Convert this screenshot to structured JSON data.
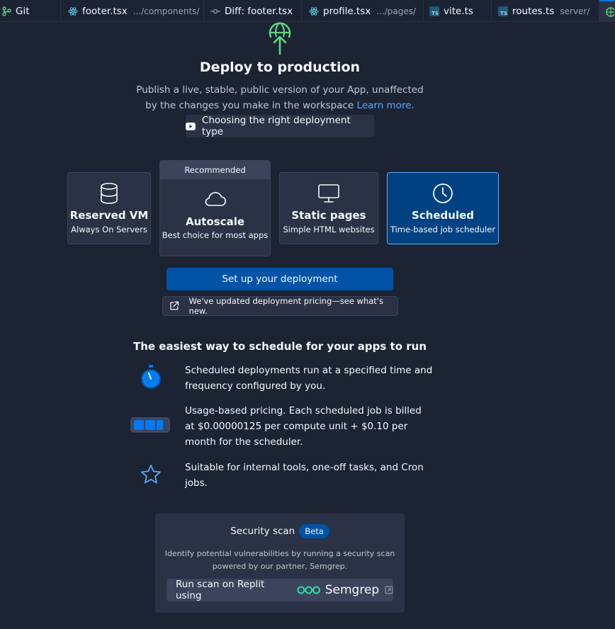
{
  "tabs": [
    {
      "label": "Git",
      "sub": "",
      "icon": "git-icon"
    },
    {
      "label": "footer.tsx",
      "sub": ".../components/",
      "icon": "react-icon"
    },
    {
      "label": "Diff: footer.tsx",
      "sub": "",
      "icon": "diff-icon"
    },
    {
      "label": "profile.tsx",
      "sub": ".../pages/",
      "icon": "react-icon"
    },
    {
      "label": "vite.ts",
      "sub": "",
      "icon": "typescript-icon"
    },
    {
      "label": "routes.ts",
      "sub": "server/",
      "icon": "typescript-icon"
    },
    {
      "label": "",
      "sub": "",
      "icon": "deployments-icon"
    }
  ],
  "hero": {
    "title": "Deploy to production",
    "description": "Publish a live, stable, public version of your App, unaffected by the changes you make in the workspace",
    "learn_more": "Learn more.",
    "video_button": "Choosing the right deployment type"
  },
  "deployment_types": [
    {
      "name": "Reserved VM",
      "subtitle": "Always On Servers",
      "icon": "database-icon"
    },
    {
      "name": "Autoscale",
      "subtitle": "Best choice for most apps",
      "icon": "cloud-icon",
      "badge": "Recommended"
    },
    {
      "name": "Static pages",
      "subtitle": "Simple HTML websites",
      "icon": "monitor-icon"
    },
    {
      "name": "Scheduled",
      "subtitle": "Time-based job scheduler",
      "icon": "clock-icon",
      "selected": true
    }
  ],
  "setup_button": "Set up your deployment",
  "pricing_link": "We've updated deployment pricing—see what's new.",
  "features": {
    "title": "The easiest way to schedule for your apps to run",
    "items": [
      {
        "icon": "stopwatch-icon",
        "text": "Scheduled deployments run at a specified time and frequency configured by you."
      },
      {
        "icon": "battery-icon",
        "text": "Usage-based pricing. Each scheduled job is billed at $0.00000125 per compute unit + $0.10 per month for the scheduler."
      },
      {
        "icon": "star-icon",
        "text": "Suitable for internal tools, one-off tasks, and Cron jobs."
      }
    ]
  },
  "security_scan": {
    "title": "Security scan",
    "badge": "Beta",
    "description": "Identify potential vulnerabilities by running a security scan powered by our partner, Semgrep.",
    "button_label": "Run scan on Replit using",
    "partner": "Semgrep"
  },
  "colors": {
    "background": "#1c2333",
    "surface": "#2b3245",
    "primary": "#0053a6",
    "selected": "#004182",
    "accent_green": "#5bd97e",
    "link": "#57abff"
  }
}
